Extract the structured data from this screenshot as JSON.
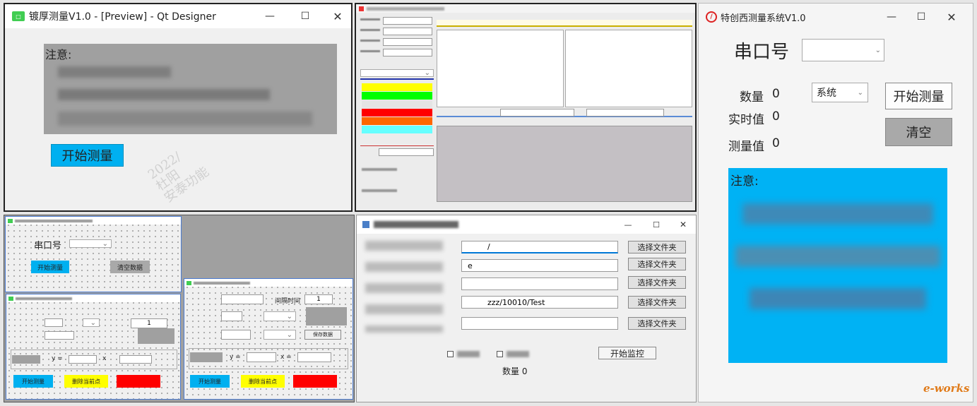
{
  "designer_window": {
    "title": "镀厚测量V1.0 - [Preview] - Qt Designer",
    "notice_label": "注意:",
    "start_button": "开始测量"
  },
  "monitor_window": {
    "start_label": "开始监控",
    "quantity_label": "数量 0",
    "folder_buttons": [
      "选择文件夹",
      "选择文件夹",
      "选择文件夹",
      "选择文件夹",
      "选择文件夹"
    ],
    "path_values": [
      "/",
      "e",
      "",
      "zzz/10010/Test",
      ""
    ]
  },
  "measure_window": {
    "title": "特创西测量系统V1.0",
    "serial_label": "串口号",
    "quantity_label": "数量",
    "quantity_value": "0",
    "realtime_label": "实时值",
    "realtime_value": "0",
    "measured_label": "测量值",
    "measured_value": "0",
    "system_combo": "系统",
    "start_button": "开始测量",
    "clear_button": "清空",
    "notice_label": "注意:"
  },
  "small_window_1": {
    "serial_label": "串口号",
    "start_button": "开始测量",
    "clear_button": "清空数据"
  },
  "small_window_2": {
    "interval_value": "1",
    "y_label": "y =",
    "x_label": "x",
    "start_button": "开始测量",
    "clear_button": "删除当前点"
  },
  "small_window_3": {
    "interval_label": "间隔时间",
    "interval_value": "1",
    "y_label": "y =",
    "x_label": "x =",
    "start_button": "开始测量",
    "clear_button": "删除当前点",
    "save_button": "保存数据"
  },
  "watermark": {
    "year": "2022/",
    "name1": "杜阳",
    "name2": "安泰功能"
  },
  "brand": "e-works",
  "colors": {
    "accent_blue": "#00b0f0",
    "notice_blue": "#00b2f4",
    "yellow": "#ffff00",
    "green": "#00ff00",
    "red": "#ff0000",
    "orange": "#ff6600",
    "cyan": "#66ffff"
  },
  "icons": {
    "app_icon": "qt-designer-icon",
    "logo_icon": "red-app-logo-icon"
  }
}
